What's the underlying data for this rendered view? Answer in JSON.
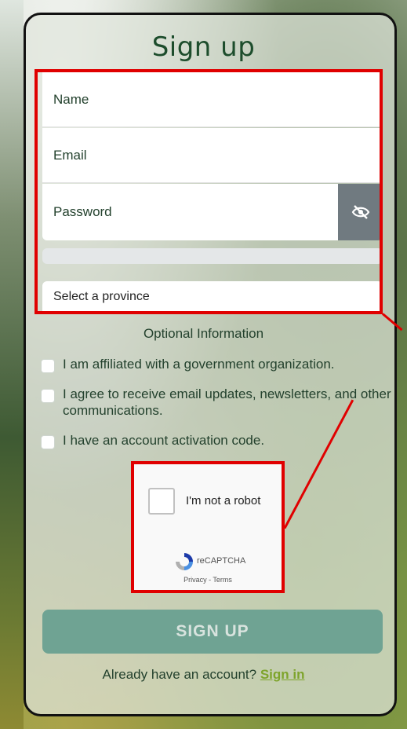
{
  "page": {
    "title": "Sign up"
  },
  "form": {
    "name_placeholder": "Name",
    "email_placeholder": "Email",
    "password_placeholder": "Password",
    "province_placeholder": "Select a province",
    "password_toggle_icon": "eye-off-icon"
  },
  "optional": {
    "heading": "Optional Information",
    "options": [
      {
        "label": "I am affiliated with a government organization.",
        "checked": false
      },
      {
        "label": "I agree to receive email updates, newsletters, and other communications.",
        "checked": false
      },
      {
        "label": "I have an account activation code.",
        "checked": false
      }
    ]
  },
  "captcha": {
    "label": "I'm not a robot",
    "brand": "reCAPTCHA",
    "links": "Privacy - Terms"
  },
  "actions": {
    "signup_label": "SIGN UP",
    "already_text": "Already have an account?",
    "signin_label": "Sign in"
  },
  "colors": {
    "title": "#1d4d2c",
    "signup_button": "#6fa393",
    "signin_link": "#7ea42b",
    "highlight": "#e00000"
  }
}
